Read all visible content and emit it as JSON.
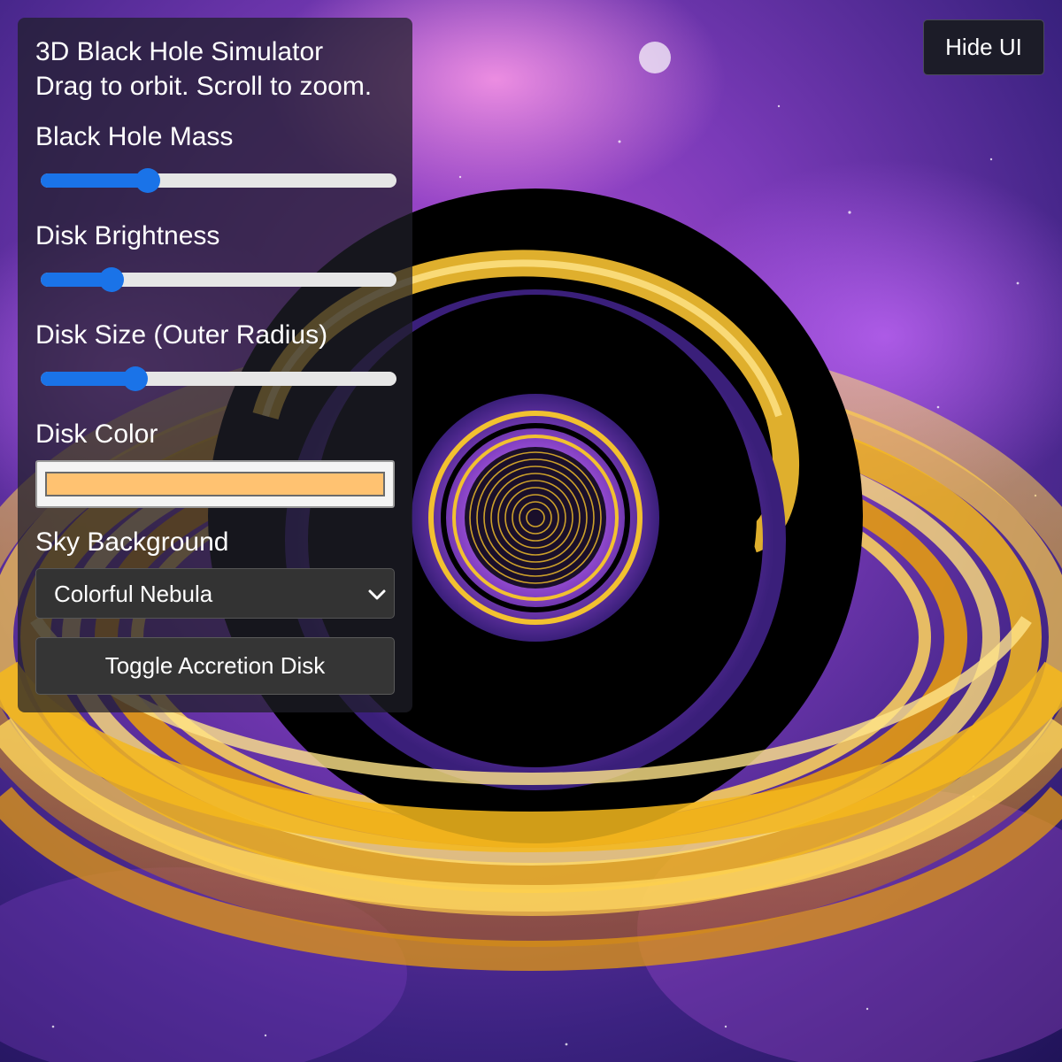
{
  "panel": {
    "title": "3D Black Hole Simulator",
    "subtitle": "Drag to orbit. Scroll to zoom.",
    "controls": {
      "mass": {
        "label": "Black Hole Mass",
        "value": 0.3
      },
      "brightness": {
        "label": "Disk Brightness",
        "value": 0.2
      },
      "disk_size": {
        "label": "Disk Size (Outer Radius)",
        "value": 0.265
      },
      "disk_color": {
        "label": "Disk Color",
        "value": "#ffc271"
      },
      "sky": {
        "label": "Sky Background",
        "selected": "Colorful Nebula"
      }
    },
    "toggle_label": "Toggle Accretion Disk"
  },
  "hide_ui_label": "Hide UI",
  "colors": {
    "accent": "#1a73e8",
    "disk_color": "#ffc271",
    "panel_bg": "#1e1e28",
    "nebula_purple": "#8a3fc0",
    "nebula_deep": "#2a1560",
    "disk_gold": "#f5b81c"
  },
  "icons": {
    "select_arrow": "chevron-down-icon"
  }
}
